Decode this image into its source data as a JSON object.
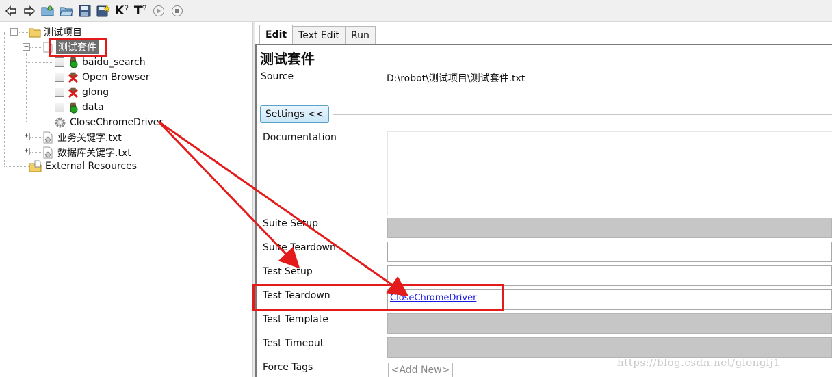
{
  "toolbar": {
    "buttons": [
      "back-icon",
      "forward-icon",
      "open-project-icon",
      "open-directory-icon",
      "save-icon",
      "save-all-icon",
      "search-keywords-icon",
      "search-tests-icon",
      "run-icon",
      "stop-icon"
    ],
    "k_label": "K",
    "t_label": "T"
  },
  "tree": {
    "root": "测试项目",
    "suite": "测试套件",
    "tests": [
      "baidu_search",
      "Open Browser",
      "glong",
      "data"
    ],
    "keyword": "CloseChromeDriver",
    "resources": [
      "业务关键字.txt",
      "数据库关键字.txt"
    ],
    "external": "External Resources"
  },
  "tabs": [
    "Edit",
    "Text Edit",
    "Run"
  ],
  "editor": {
    "title": "测试套件",
    "source_label": "Source",
    "source_value": "D:\\robot\\测试项目\\测试套件.txt",
    "settings_button": "Settings <<",
    "fields": {
      "documentation": "Documentation",
      "suite_setup": "Suite Setup",
      "suite_teardown": "Suite Teardown",
      "test_setup": "Test Setup",
      "test_teardown": "Test Teardown",
      "test_teardown_value": "CloseChromeDriver",
      "test_template": "Test Template",
      "test_timeout": "Test Timeout",
      "force_tags": "Force Tags",
      "add_new": "<Add New>"
    }
  },
  "watermark": "https://blog.csdn.net/glonglj1",
  "colors": {
    "highlight": "#e31b1b",
    "link": "#1a1ae6",
    "disabled_field": "#c6c6c6",
    "selected_node": "#6d6d6d"
  }
}
